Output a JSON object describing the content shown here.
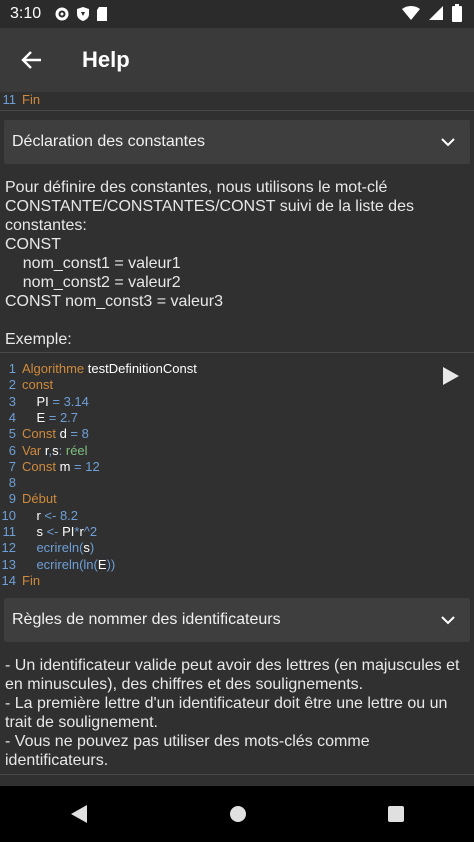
{
  "status": {
    "time": "3:10"
  },
  "appbar": {
    "title": "Help"
  },
  "top_code": {
    "ln": "11",
    "code": "Fin"
  },
  "section1": {
    "header": "Déclaration des constantes",
    "text": "Pour définire des constantes, nous utilisons le mot-clé CONSTANTE/CONSTANTES/CONST suivi de la liste des constantes:\nCONST\n    nom_const1 = valeur1\n    nom_const2 = valeur2\nCONST nom_const3 = valeur3\n\nExemple:"
  },
  "code1": [
    {
      "n": "1",
      "parts": [
        [
          "kw",
          "Algorithme "
        ],
        [
          "ident",
          "testDefinitionConst"
        ]
      ]
    },
    {
      "n": "2",
      "parts": [
        [
          "kw",
          "const"
        ]
      ]
    },
    {
      "n": "3",
      "parts": [
        [
          "ident",
          "    PI"
        ],
        [
          "op",
          " = "
        ],
        [
          "num",
          "3.14"
        ]
      ]
    },
    {
      "n": "4",
      "parts": [
        [
          "ident",
          "    E"
        ],
        [
          "op",
          " = "
        ],
        [
          "num",
          "2.7"
        ]
      ]
    },
    {
      "n": "5",
      "parts": [
        [
          "kw",
          "Const "
        ],
        [
          "ident",
          "d"
        ],
        [
          "op",
          " = "
        ],
        [
          "num",
          "8"
        ]
      ]
    },
    {
      "n": "6",
      "parts": [
        [
          "kw",
          "Var "
        ],
        [
          "ident",
          "r"
        ],
        [
          "op",
          ","
        ],
        [
          "ident",
          "s"
        ],
        [
          "op",
          ": "
        ],
        [
          "typ",
          "réel"
        ]
      ]
    },
    {
      "n": "7",
      "parts": [
        [
          "kw",
          "Const "
        ],
        [
          "ident",
          "m"
        ],
        [
          "op",
          " = "
        ],
        [
          "num",
          "12"
        ]
      ]
    },
    {
      "n": "8",
      "parts": []
    },
    {
      "n": "9",
      "parts": [
        [
          "kw",
          "Début"
        ]
      ]
    },
    {
      "n": "10",
      "parts": [
        [
          "ident",
          "    r"
        ],
        [
          "op",
          " <- "
        ],
        [
          "num",
          "8.2"
        ]
      ]
    },
    {
      "n": "11",
      "parts": [
        [
          "ident",
          "    s"
        ],
        [
          "op",
          " <- "
        ],
        [
          "ident",
          "PI"
        ],
        [
          "op",
          "*"
        ],
        [
          "ident",
          "r"
        ],
        [
          "op",
          "^"
        ],
        [
          "num",
          "2"
        ]
      ]
    },
    {
      "n": "12",
      "parts": [
        [
          "fn",
          "    ecrireln"
        ],
        [
          "op",
          "("
        ],
        [
          "ident",
          "s"
        ],
        [
          "op",
          ")"
        ]
      ]
    },
    {
      "n": "13",
      "parts": [
        [
          "fn",
          "    ecrireln"
        ],
        [
          "op",
          "("
        ],
        [
          "fn",
          "ln"
        ],
        [
          "op",
          "("
        ],
        [
          "ident",
          "E"
        ],
        [
          "op",
          "))"
        ]
      ]
    },
    {
      "n": "14",
      "parts": [
        [
          "kw",
          "Fin"
        ]
      ]
    }
  ],
  "section2": {
    "header": "Règles de nommer des identificateurs",
    "text": "- Un identificateur valide peut avoir des lettres (en majuscules et en minuscules), des chiffres et des soulignements.\n- La première lettre d'un identificateur doit être une lettre ou un trait de soulignement.\n- Vous ne pouvez pas utiliser des mots-clés comme identificateurs."
  },
  "colors": {
    "keyword": "#d08a3c",
    "number": "#6e9fd6",
    "type": "#7fbf7f",
    "background": "#303030"
  },
  "icons": [
    "gear-icon",
    "shield-icon",
    "sd-card-icon",
    "wifi-icon",
    "signal-icon",
    "battery-icon",
    "back-arrow-icon",
    "chevron-down-icon",
    "play-icon",
    "nav-back-icon",
    "nav-home-icon",
    "nav-recents-icon"
  ]
}
